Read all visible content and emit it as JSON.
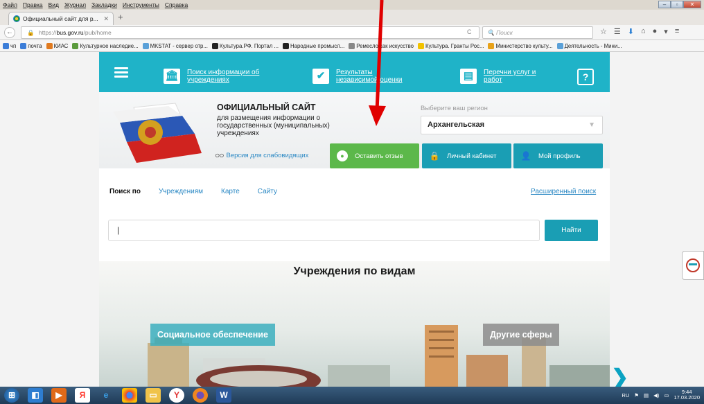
{
  "browser": {
    "menu": [
      "Файл",
      "Правка",
      "Вид",
      "Журнал",
      "Закладки",
      "Инструменты",
      "Справка"
    ],
    "tab_title": "Официальный сайт для р...",
    "url_prefix": "https://",
    "url_domain": "bus.gov.ru",
    "url_path": "/pub/home",
    "search_placeholder": "Поиск",
    "bookmarks": [
      {
        "label": "чп",
        "color": "#3b7dd8"
      },
      {
        "label": "почта",
        "color": "#3b7dd8"
      },
      {
        "label": "КИАС",
        "color": "#e07a1f"
      },
      {
        "label": "Культурное наследие...",
        "color": "#5a9a3c"
      },
      {
        "label": "MKSTAT - сервер отр...",
        "color": "#5aa0d8"
      },
      {
        "label": "Культура.РФ. Портал ...",
        "color": "#222222"
      },
      {
        "label": "Народные промысл...",
        "color": "#222222"
      },
      {
        "label": "Ремесло как искусство",
        "color": "#888888"
      },
      {
        "label": "Культура. Гранты Рос...",
        "color": "#f2c200"
      },
      {
        "label": "Министерство культу...",
        "color": "#e8a21a"
      },
      {
        "label": "Деятельность - Мини...",
        "color": "#5aa0d8"
      }
    ]
  },
  "site": {
    "nav": {
      "institutions": "Поиск информации об учреждениях",
      "results": "Результаты независимой оценки",
      "lists": "Перечни услуг и работ"
    },
    "title": "ОФИЦИАЛЬНЫЙ САЙТ",
    "subtitle": "для размещения информации о государственных (муниципальных) учреждениях",
    "low_vision": "Версия для слабовидящих",
    "region_label": "Выберите ваш регион",
    "region_value": "Архангельская",
    "buttons": {
      "review": "Оставить отзыв",
      "cabinet": "Личный кабинет",
      "profile": "Мой профиль"
    },
    "search": {
      "lead": "Поиск по",
      "tabs": [
        "Учреждениям",
        "Карте",
        "Сайту"
      ],
      "advanced": "Расширенный поиск",
      "input_value": "",
      "button": "Найти"
    },
    "kinds": {
      "title": "Учреждения по видам",
      "labels": [
        "Социальное обеспечение",
        "Другие сферы"
      ]
    }
  },
  "taskbar": {
    "lang": "RU",
    "time": "9:44",
    "date": "17.03.2020"
  },
  "colors": {
    "accent": "#1fb3c8",
    "button_primary": "#1a9eb4",
    "button_review": "#5cb84a",
    "annotation_arrow": "#e00000"
  }
}
